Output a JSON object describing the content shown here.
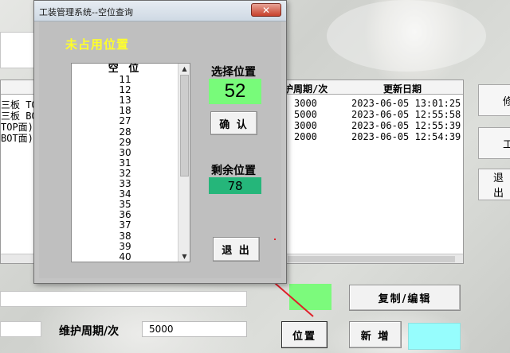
{
  "dialog": {
    "title": "工装管理系统--空位查询",
    "close_glyph": "✕",
    "heading": "未占用位置",
    "list_header": "空 位",
    "list_items": [
      "11",
      "12",
      "13",
      "18",
      "27",
      "28",
      "29",
      "30",
      "31",
      "32",
      "33",
      "34",
      "35",
      "36",
      "37",
      "38",
      "39",
      "40"
    ],
    "selected_label": "选择位置",
    "selected_value": "52",
    "confirm_label": "确 认",
    "remaining_label": "剩余位置",
    "remaining_value": "78",
    "exit_label": "退 出"
  },
  "main": {
    "table": {
      "col_maintain_header": "护周期/次",
      "col_update_header": "更新日期",
      "rows": [
        {
          "name": "三板 TOP",
          "cycle": "3000",
          "date": "2023-06-05 13:01:25"
        },
        {
          "name": "三板 BOT",
          "cycle": "5000",
          "date": "2023-06-05 12:55:58"
        },
        {
          "name": "TOP面)",
          "cycle": "3000",
          "date": "2023-06-05 12:55:39"
        },
        {
          "name": "BOT面)",
          "cycle": "2000",
          "date": "2023-06-05 12:54:39"
        }
      ]
    },
    "right_buttons": [
      "修",
      "工",
      "退出"
    ],
    "copy_edit_label": "复制/编辑",
    "position_button_label": "位置",
    "new_button_label": "新 増",
    "maintain_cycle_label": "维护周期/次",
    "maintain_cycle_value": "5000"
  },
  "colors": {
    "selected_bg": "#78fb7a",
    "remaining_bg": "#25b67a",
    "heading_color": "#ffff2a",
    "arrow_color": "#e0202a"
  }
}
